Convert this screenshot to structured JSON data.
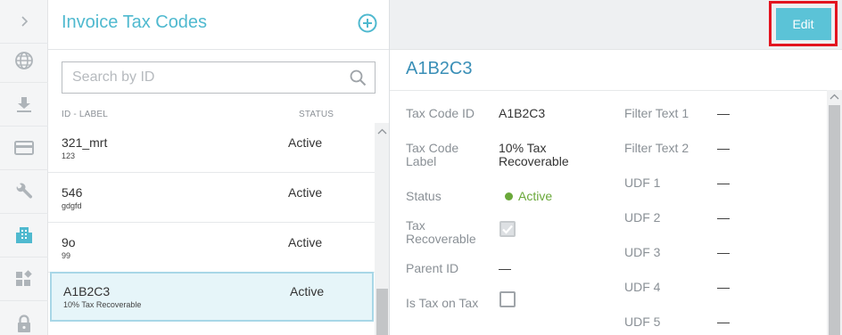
{
  "rail": {
    "items": [
      {
        "icon": "chevron-right-icon"
      },
      {
        "icon": "globe-icon"
      },
      {
        "icon": "download-icon"
      },
      {
        "icon": "credit-card-icon"
      },
      {
        "icon": "wrench-icon"
      },
      {
        "icon": "building-icon",
        "active": true
      },
      {
        "icon": "widgets-icon"
      },
      {
        "icon": "lock-icon"
      }
    ]
  },
  "list": {
    "title": "Invoice Tax Codes",
    "search_placeholder": "Search by ID",
    "col_id_label": "ID - LABEL",
    "col_status": "STATUS",
    "rows": [
      {
        "id": "321_mrt",
        "label": "123",
        "status": "Active"
      },
      {
        "id": "546",
        "label": "gdgfd",
        "status": "Active"
      },
      {
        "id": "9o",
        "label": "99",
        "status": "Active"
      },
      {
        "id": "A1B2C3",
        "label": "10% Tax Recoverable",
        "status": "Active",
        "selected": true
      }
    ]
  },
  "detail": {
    "edit_label": "Edit",
    "title": "A1B2C3",
    "left_fields": {
      "tax_code_id_label": "Tax Code ID",
      "tax_code_id_value": "A1B2C3",
      "tax_code_label_l1": "Tax Code",
      "tax_code_label_l2": "Label",
      "tax_code_label_value_l1": "10% Tax",
      "tax_code_label_value_l2": "Recoverable",
      "status_label": "Status",
      "status_value": "Active",
      "tax_recoverable_l1": "Tax",
      "tax_recoverable_l2": "Recoverable",
      "tax_recoverable_checked": true,
      "parent_id_label": "Parent ID",
      "parent_id_value": "—",
      "is_tax_on_tax_label": "Is Tax on Tax",
      "is_tax_on_tax_checked": false
    },
    "right_fields": [
      {
        "label": "Filter Text 1",
        "value": "—"
      },
      {
        "label": "Filter Text 2",
        "value": "—"
      },
      {
        "label": "UDF 1",
        "value": "—"
      },
      {
        "label": "UDF 2",
        "value": "—"
      },
      {
        "label": "UDF 3",
        "value": "—"
      },
      {
        "label": "UDF 4",
        "value": "—"
      },
      {
        "label": "UDF 5",
        "value": "—"
      }
    ]
  },
  "colors": {
    "accent": "#4fb9cf",
    "title_blue": "#3a8fb7",
    "edit_button": "#5bc3d7",
    "highlight_box": "#e3141f",
    "active_green": "#6aa83a",
    "selected_row_bg": "#e6f5f9"
  }
}
